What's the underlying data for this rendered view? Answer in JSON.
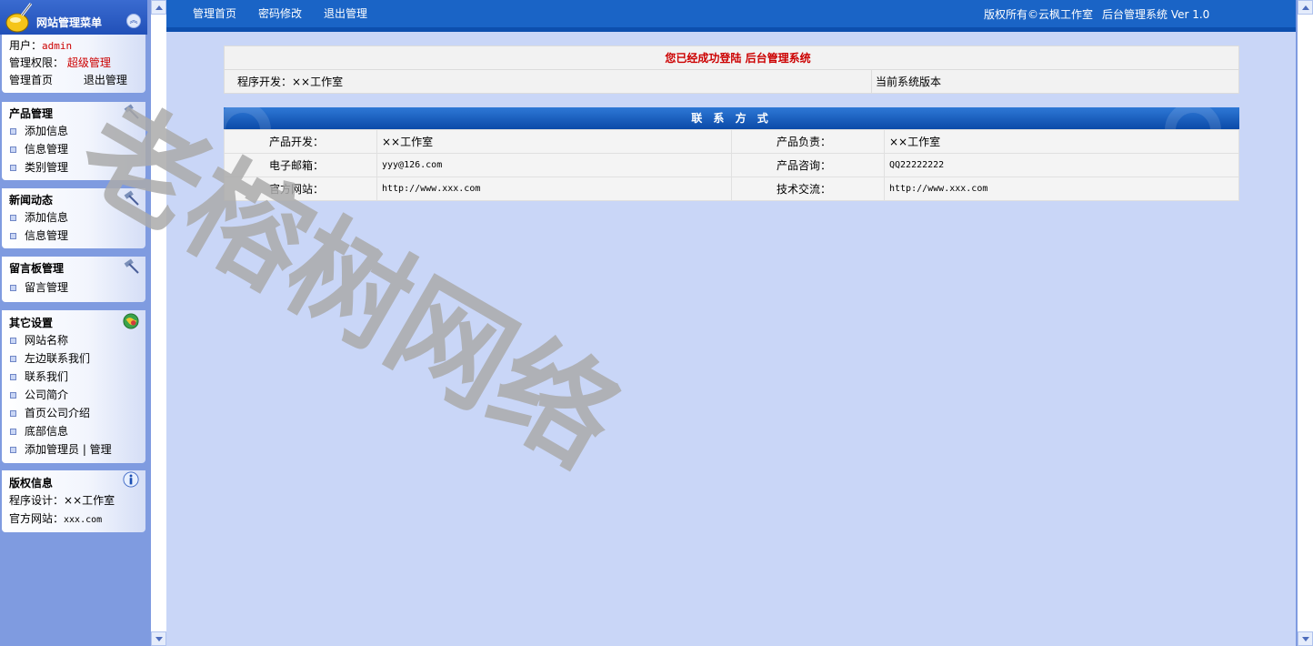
{
  "menu": {
    "title": "网站管理菜单",
    "user_label": "用户：",
    "user_value": "admin",
    "perm_label": "管理权限：",
    "perm_value": "超级管理",
    "home_link": "管理首页",
    "logout_link": "退出管理",
    "sections": [
      {
        "title": "产品管理",
        "icon": "hammer-icon",
        "items": [
          "添加信息",
          "信息管理",
          "类别管理"
        ]
      },
      {
        "title": "新闻动态",
        "icon": "hammer-icon",
        "items": [
          "添加信息",
          "信息管理"
        ]
      },
      {
        "title": "留言板管理",
        "icon": "hammer-icon",
        "items": [
          "留言管理"
        ]
      },
      {
        "title": "其它设置",
        "icon": "globe-icon",
        "items": [
          "网站名称",
          "左边联系我们",
          "联系我们",
          "公司简介",
          "首页公司介绍",
          "底部信息",
          "添加管理员 | 管理"
        ]
      }
    ],
    "copyright": {
      "title": "版权信息",
      "icon": "info-icon",
      "designer_label": "程序设计：",
      "designer_value": "××工作室",
      "site_label": "官方网站：",
      "site_value": "xxx.com"
    }
  },
  "topbar": {
    "nav": [
      "管理首页",
      "密码修改",
      "退出管理"
    ],
    "copyright": "版权所有©云枫工作室",
    "system": "后台管理系统 Ver 1.0"
  },
  "status": {
    "message": "您已经成功登陆 后台管理系统",
    "developer": "程序开发：××工作室",
    "version": "当前系统版本"
  },
  "contact": {
    "title": "联 系 方 式",
    "rows": [
      {
        "l1": "产品开发：",
        "v1": "××工作室",
        "l2": "产品负责：",
        "v2": "××工作室"
      },
      {
        "l1": "电子邮箱：",
        "v1": "yyy@126.com",
        "l2": "产品咨询：",
        "v2": "QQ22222222"
      },
      {
        "l1": "官方网站：",
        "v1": "http://www.xxx.com",
        "l2": "技术交流：",
        "v2": "http://www.xxx.com"
      }
    ]
  },
  "watermark": "老榕树网络",
  "colors": {
    "topbar": "#1a64c6",
    "main_bg": "#c9d6f7",
    "left_bg": "#7f9be0",
    "accent_red": "#cc0000"
  }
}
